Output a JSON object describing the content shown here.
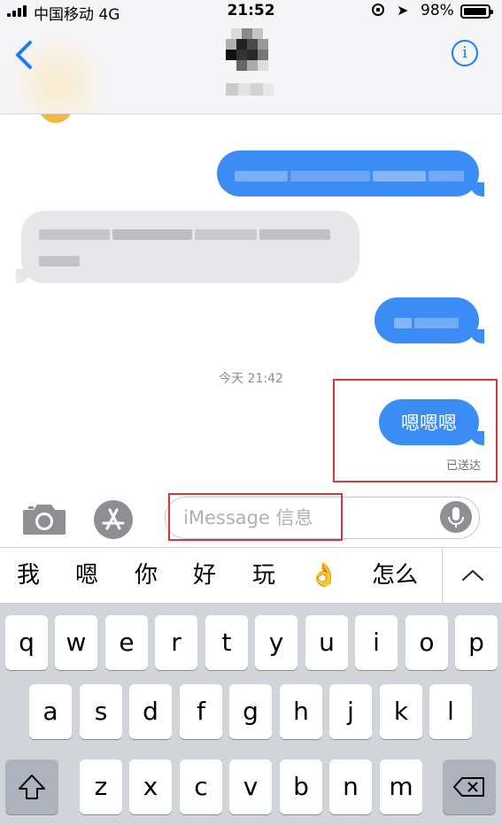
{
  "status_bar": {
    "carrier": "中国移动  4G",
    "time": "21:52",
    "battery_pct": "98%",
    "battery_level": 0.98
  },
  "nav": {
    "back_icon": "chevron-left-icon",
    "info_icon": "info-icon",
    "info_glyph": "i"
  },
  "thread": {
    "timestamp": "今天 21:42",
    "last_message": "嗯嗯嗯",
    "delivered": "已送达"
  },
  "input": {
    "placeholder": "iMessage 信息"
  },
  "suggestions": [
    "我",
    "嗯",
    "你",
    "好",
    "玩",
    "👌",
    "怎么"
  ],
  "keyboard": {
    "row1": [
      "q",
      "w",
      "e",
      "r",
      "t",
      "y",
      "u",
      "i",
      "o",
      "p"
    ],
    "row2": [
      "a",
      "s",
      "d",
      "f",
      "g",
      "h",
      "j",
      "k",
      "l"
    ],
    "row3": [
      "z",
      "x",
      "c",
      "v",
      "b",
      "n",
      "m"
    ]
  },
  "colors": {
    "accent": "#1a7cf8",
    "sent_bubble": "#3c8cf5",
    "received_bubble": "#e7e7ea",
    "highlight": "#d33b3b"
  }
}
